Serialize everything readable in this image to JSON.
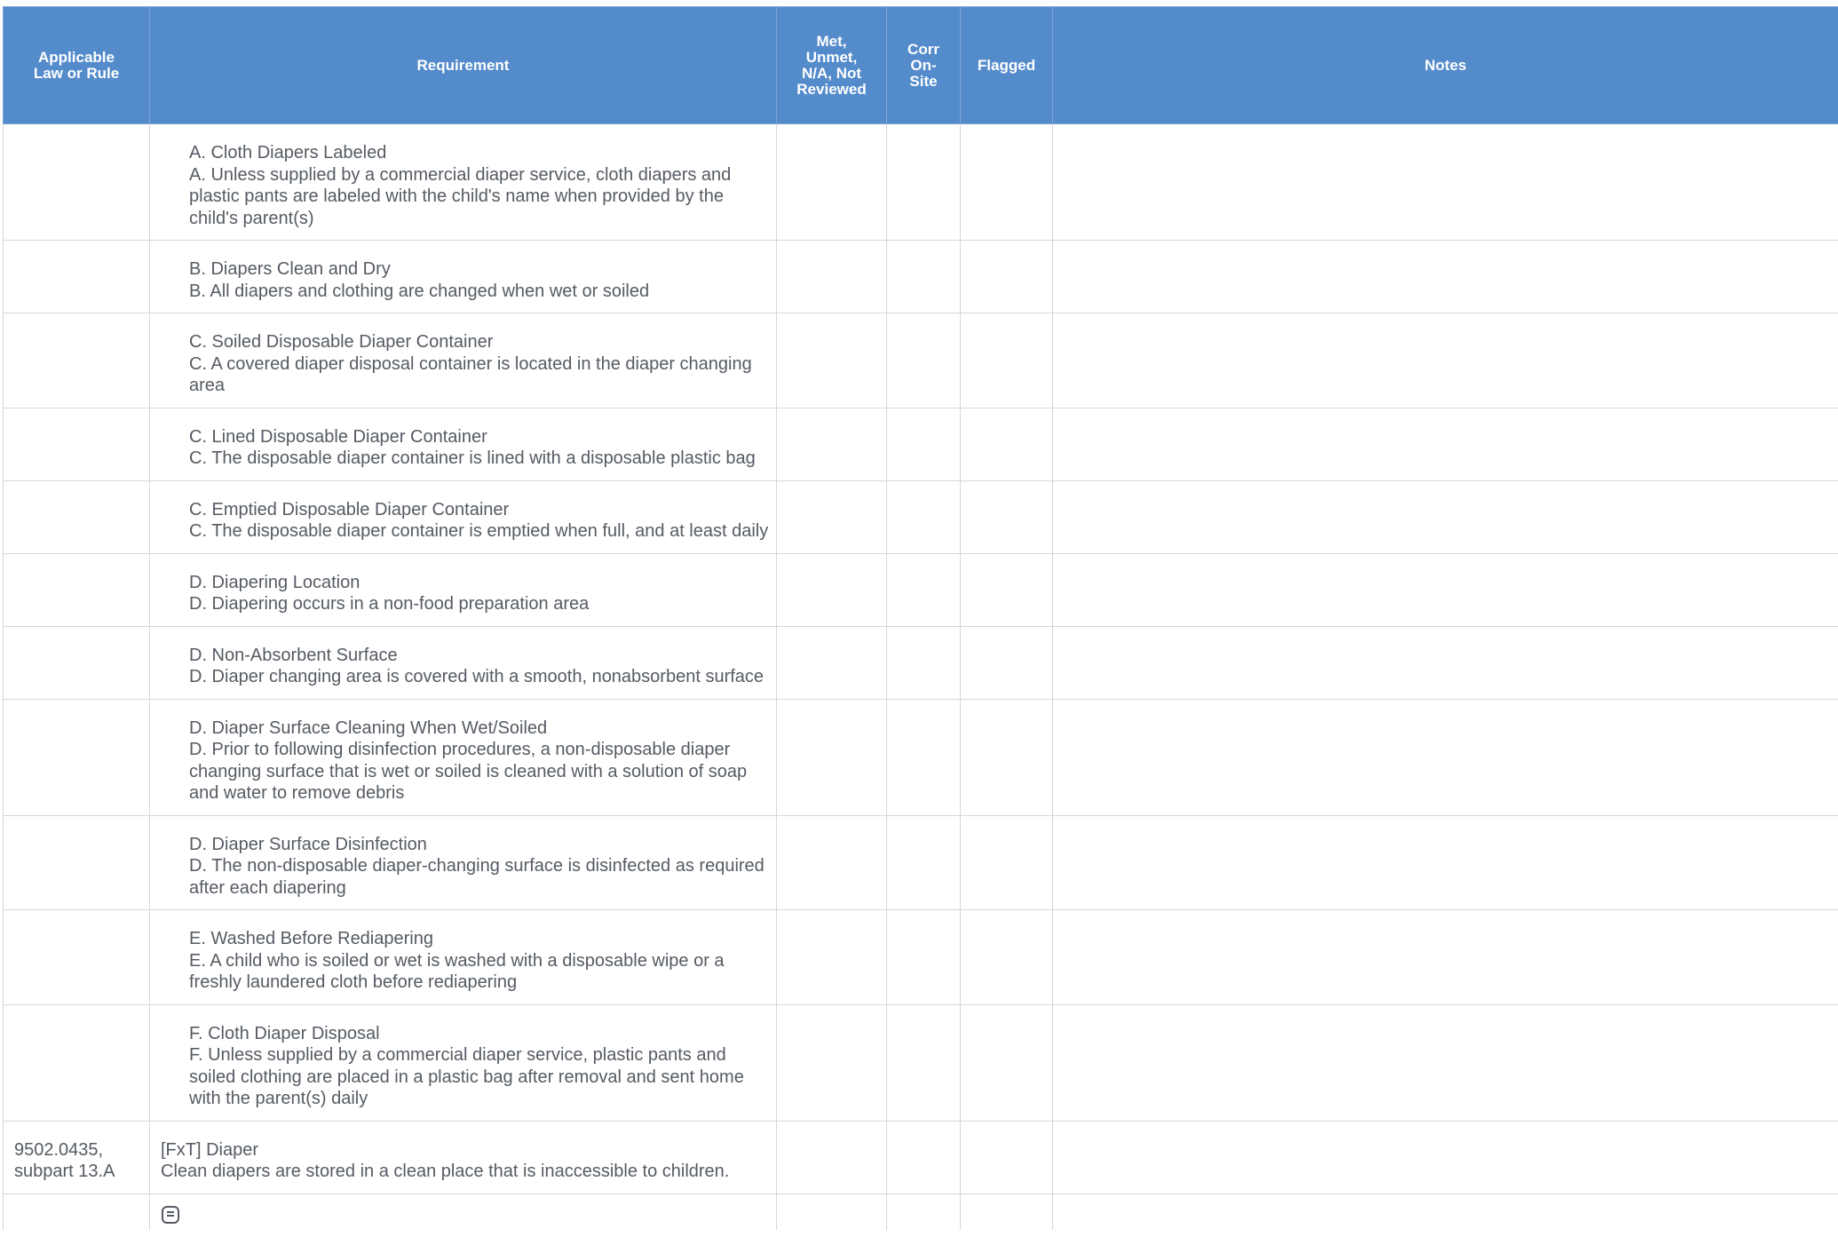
{
  "table": {
    "headers": {
      "law": "Applicable Law or Rule",
      "requirement": "Requirement",
      "met": "Met, Unmet, N/A, Not Reviewed",
      "corr": "Corr On-Site",
      "flagged": "Flagged",
      "notes": "Notes"
    },
    "rows": [
      {
        "law": "",
        "title": "A. Cloth Diapers Labeled",
        "desc": "A. Unless supplied by a commercial diaper service, cloth diapers and plastic pants are labeled with the child's name when provided by the child's parent(s)"
      },
      {
        "law": "",
        "title": "B. Diapers Clean and Dry",
        "desc": "B. All diapers and clothing are changed when wet or soiled"
      },
      {
        "law": "",
        "title": "C. Soiled Disposable Diaper Container",
        "desc": "C. A covered diaper disposal container is located in the diaper changing area"
      },
      {
        "law": "",
        "title": "C. Lined Disposable Diaper Container",
        "desc": "C. The disposable diaper container is lined with a disposable plastic bag"
      },
      {
        "law": "",
        "title": "C. Emptied Disposable Diaper Container",
        "desc": "C. The disposable diaper container is emptied when full, and at least daily"
      },
      {
        "law": "",
        "title": "D. Diapering Location",
        "desc": "D. Diapering occurs in a non-food preparation area"
      },
      {
        "law": "",
        "title": "D. Non-Absorbent Surface",
        "desc": "D. Diaper changing area is covered with a smooth, nonabsorbent surface"
      },
      {
        "law": "",
        "title": "D. Diaper Surface Cleaning When Wet/Soiled",
        "desc": "D. Prior to following disinfection procedures, a non-disposable diaper changing surface that is wet or soiled is cleaned with a solution of soap and water to remove debris"
      },
      {
        "law": "",
        "title": "D. Diaper Surface Disinfection",
        "desc": "D. The non-disposable diaper-changing surface is disinfected as required after each diapering"
      },
      {
        "law": "",
        "title": "E. Washed Before Rediapering",
        "desc": "E. A child who is soiled or wet is washed with a disposable wipe or a freshly laundered cloth before rediapering"
      },
      {
        "law": "",
        "title": "F. Cloth Diaper Disposal",
        "desc": "F. Unless supplied by a commercial diaper service, plastic pants and soiled clothing are placed in a plastic bag after removal and sent home with the parent(s) daily"
      },
      {
        "law": "9502.0435, subpart 13.A",
        "title": "[FxT] Diaper",
        "desc": "Clean diapers are stored in a clean place that is inaccessible to children."
      }
    ],
    "tail_icon": "document-icon"
  }
}
